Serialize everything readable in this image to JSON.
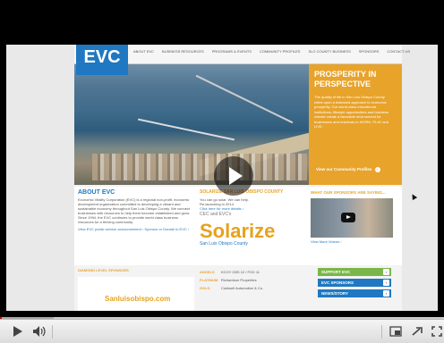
{
  "player": {
    "progress_fraction": 0.005,
    "buffered_fraction": 0.12,
    "controls": [
      "play-icon",
      "volume-icon",
      "miniplayer-icon",
      "popout-icon",
      "fullscreen-icon"
    ]
  },
  "site": {
    "logo": "EVC",
    "nav": [
      "ABOUT EVC",
      "BUSINESS RESOURCES",
      "PROGRAMS & EVENTS",
      "COMMUNITY PROFILES",
      "SLO COUNTY BUSINESS",
      "SPONSORS",
      "CONTACT US"
    ],
    "promo": {
      "title": "PROSPERITY IN PERSPECTIVE",
      "body": "The quality of life in San Luis Obispo County relies upon a balanced approach to economic prosperity. Our world-class educational institutions, lifestyle opportunities and business climate create a favorable environment for businesses and residents to WORK, PLAY and LIVE.",
      "link": "View our Community Profiles"
    },
    "about": {
      "title": "ABOUT EVC",
      "body": "Economic Vitality Corporation (EVC) is a regional non-profit, economic development organization committed to developing a vibrant and sustainable economy throughout San Luis Obispo County. We connect businesses with resources to help them become established and grow. Since 1994, the EVC continues to provide world class business resources for a thriving community.",
      "links": "View EVC public service announcement › Sponsor or Donate to EVC ›"
    },
    "solar": {
      "title": "SOLARIZE SAN LUIS OBISPO COUNTY",
      "line1": "You can go solar. We can help.",
      "line2": "Re-launching in 2014.",
      "line3": "Click here for more details ›",
      "cec": "CEC and EVC's",
      "big": "Solarize",
      "sub": "San Luis Obispo County"
    },
    "sponsors": {
      "title": "WHAT OUR SPONSORS ARE SAYING...",
      "more": "View More Videos ›"
    },
    "row3": {
      "gold_label": "DIAMOND LEVEL SPONSORS",
      "card_text": "Sanluisobispo.com",
      "tiers": [
        {
          "k": "ANGELS",
          "v": "KCOY CBS 12 / FOX 11"
        },
        {
          "k": "PLATINUM",
          "v": "Richardson Properties"
        },
        {
          "k": "GOLD",
          "v": "Coldwell Automotive & Co."
        }
      ],
      "buttons": [
        {
          "label": "SUPPORT EVC",
          "color": "#7ab648"
        },
        {
          "label": "EVC SPONSORS",
          "color": "#1f78c1"
        },
        {
          "label": "NEWS/STORY",
          "color": "#1f78c1"
        }
      ]
    }
  }
}
